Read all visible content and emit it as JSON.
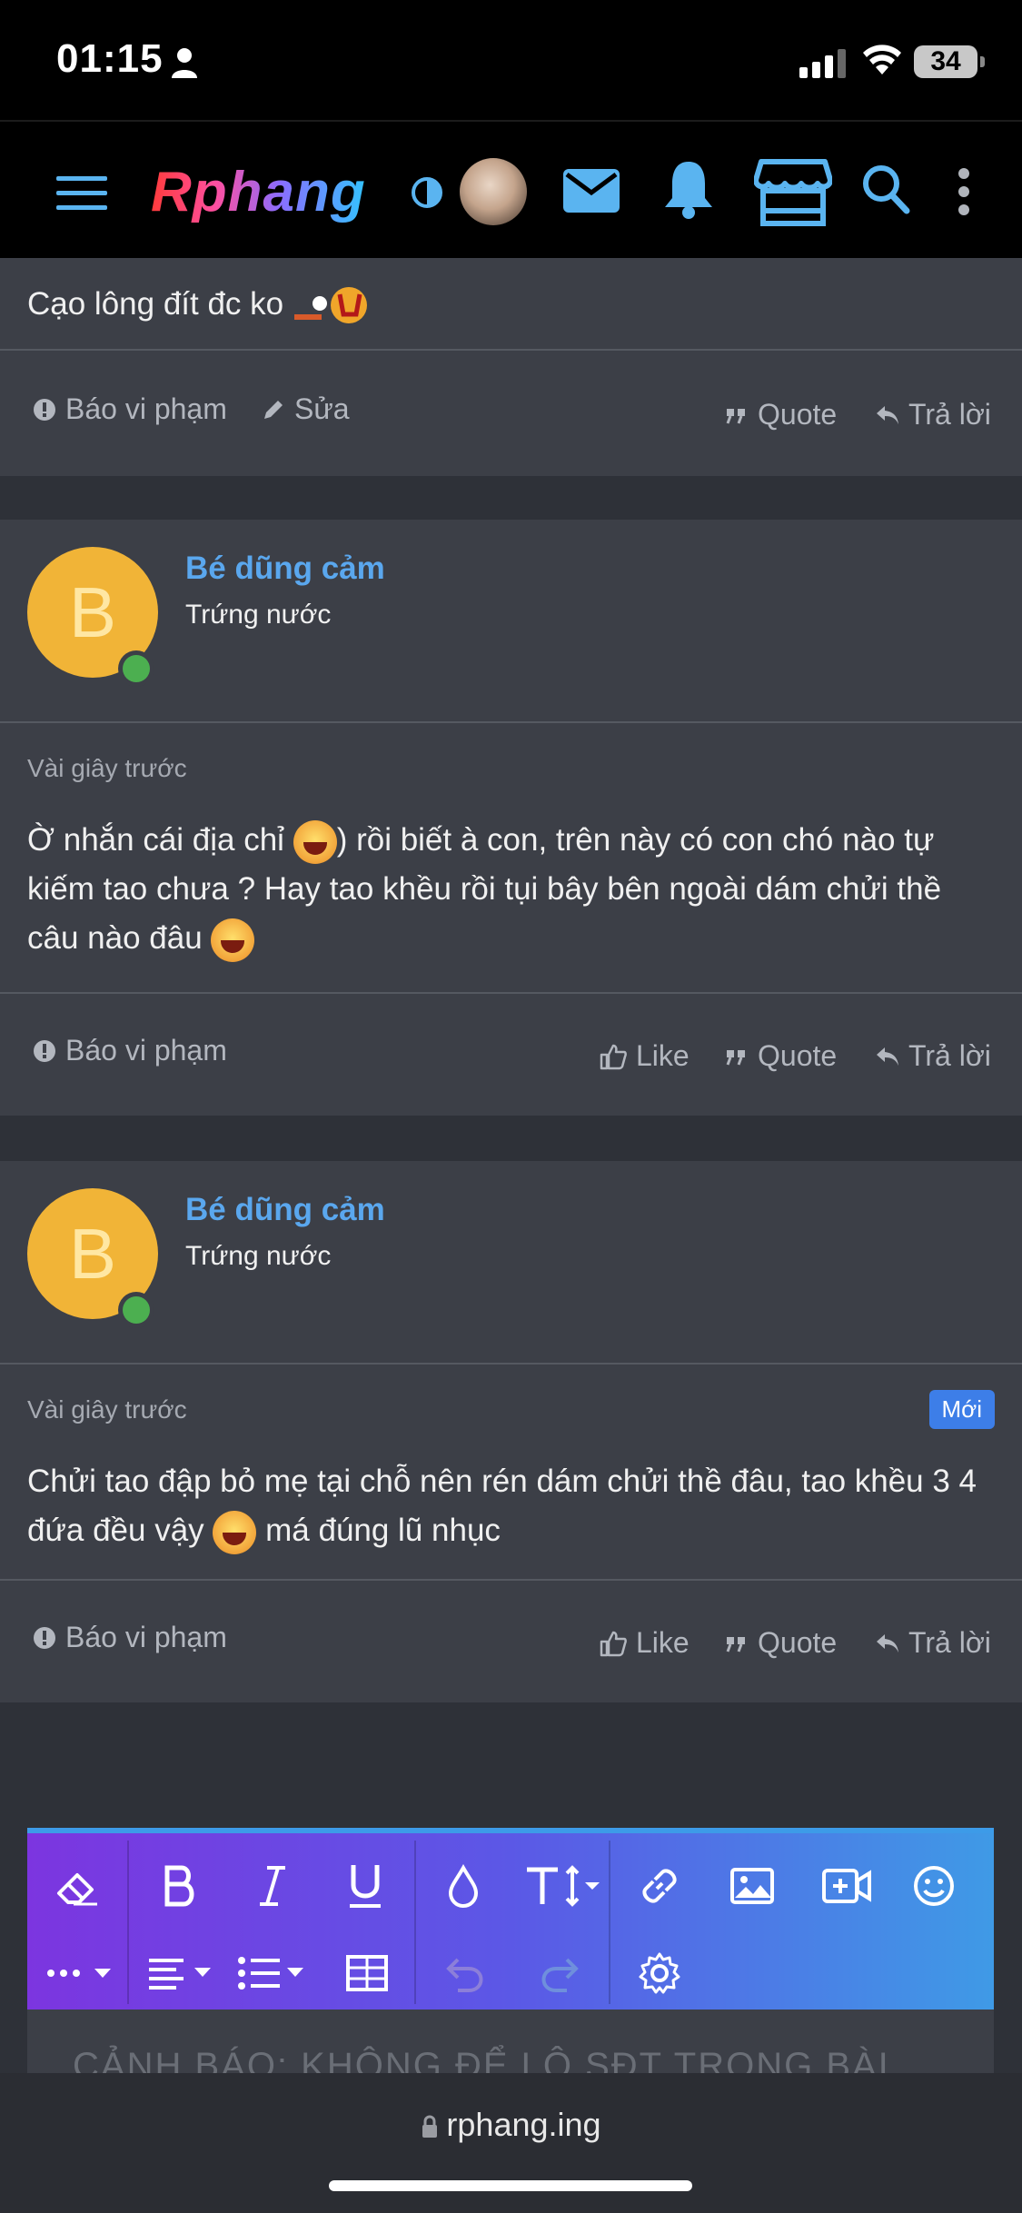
{
  "status_bar": {
    "time": "01:15",
    "battery": "34"
  },
  "header": {
    "logo": "Rphang"
  },
  "top_post": {
    "text": "Cạo lông đít đc ko",
    "actions": {
      "report": "Báo vi phạm",
      "edit": "Sửa",
      "quote": "Quote",
      "reply": "Trả lời"
    }
  },
  "posts": [
    {
      "avatar_letter": "B",
      "username": "Bé dũng cảm",
      "user_title": "Trứng nước",
      "timestamp": "Vài giây trước",
      "text_1": "Ờ nhắn cái địa chỉ ",
      "text_2": ") rồi biết à con, trên này có con chó nào tự kiếm tao chưa ? Hay tao khều rồi tụi bây bên ngoài dám chửi thề câu nào đâu ",
      "actions": {
        "report": "Báo vi phạm",
        "like": "Like",
        "quote": "Quote",
        "reply": "Trả lời"
      }
    },
    {
      "avatar_letter": "B",
      "username": "Bé dũng cảm",
      "user_title": "Trứng nước",
      "timestamp": "Vài giây trước",
      "badge": "Mới",
      "text_1": "Chửi tao đập bỏ mẹ tại chỗ nên rén dám chửi thề đâu, tao khều 3 4 đứa đều vậy ",
      "text_2": " má đúng lũ nhục",
      "actions": {
        "report": "Báo vi phạm",
        "like": "Like",
        "quote": "Quote",
        "reply": "Trả lời"
      }
    }
  ],
  "editor": {
    "placeholder": "CẢNH BÁO: KHÔNG ĐỂ LỘ SĐT TRONG BÀI"
  },
  "browser": {
    "url": "rphang.ing"
  },
  "colors": {
    "accent": "#5aa7ee",
    "avatar": "#f1b437",
    "badge": "#3d7ee8",
    "online": "#4caf50"
  }
}
